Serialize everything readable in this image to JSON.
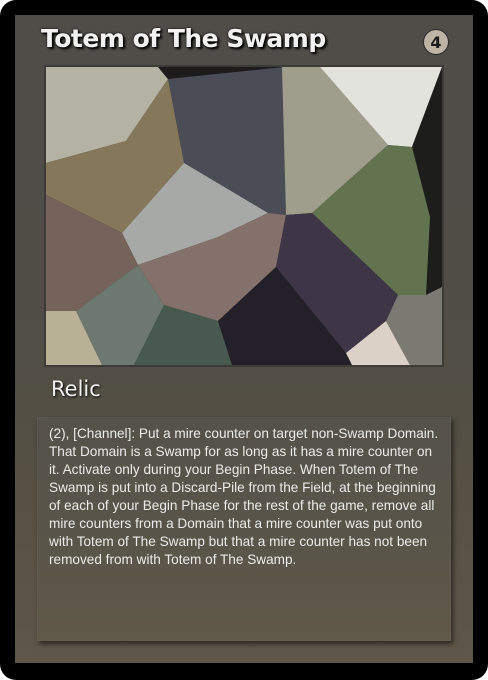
{
  "card": {
    "title": "Totem of The Swamp",
    "cost": "4",
    "type": "Relic",
    "rules_text": "(2), [Channel]: Put a mire counter on target non-Swamp Domain. That Domain is a Swamp for as long as it has a mire counter on it. Activate only during your Begin Phase. When Totem of The Swamp is put into a Discard-Pile from the Field, at the beginning of each of your Begin Phase for the rest of the game, remove all mire counters from a Domain that a mire counter was put onto with Totem of The Swamp but that a mire counter has not been removed from with Totem of The Swamp."
  },
  "colors": {
    "frame": "#000000",
    "face": "#4f4d46",
    "title_text": "#f2f2f2",
    "cost_badge": "#bdb4a6"
  },
  "icons": {
    "cost": "mana-cost-circle"
  }
}
